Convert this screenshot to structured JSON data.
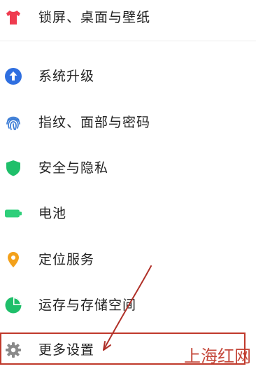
{
  "settings": {
    "items": [
      {
        "label": "锁屏、桌面与壁纸",
        "icon": "tshirt-icon",
        "color": "#ef3b4f"
      },
      {
        "label": "系统升级",
        "icon": "upgrade-arrow-icon",
        "color": "#2f6fe0"
      },
      {
        "label": "指纹、面部与密码",
        "icon": "fingerprint-icon",
        "color": "#3a7bd5"
      },
      {
        "label": "安全与隐私",
        "icon": "shield-icon",
        "color": "#1fbf6a"
      },
      {
        "label": "电池",
        "icon": "battery-icon",
        "color": "#2ecf7a"
      },
      {
        "label": "定位服务",
        "icon": "location-pin-icon",
        "color": "#f3a11b"
      },
      {
        "label": "运存与存储空间",
        "icon": "pie-chart-icon",
        "color": "#1fbf6a"
      },
      {
        "label": "更多设置",
        "icon": "gear-icon",
        "color": "#8a8a8a"
      }
    ]
  },
  "annotation": {
    "highlight_color": "#c0392b",
    "highlighted_item": "更多设置"
  },
  "watermark": {
    "text": "上海红网"
  }
}
